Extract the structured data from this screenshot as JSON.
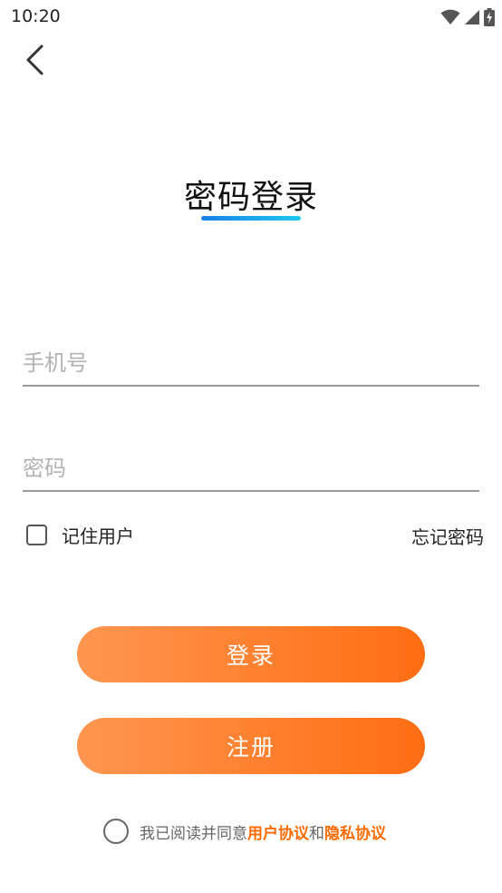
{
  "status_bar": {
    "time": "10:20"
  },
  "title": "密码登录",
  "phone_field": {
    "value": "",
    "placeholder": "手机号"
  },
  "password_field": {
    "value": "",
    "placeholder": "密码"
  },
  "remember": {
    "label": "记住用户",
    "checked": false
  },
  "forgot_password": "忘记密码",
  "buttons": {
    "login": "登录",
    "register": "注册"
  },
  "agreement": {
    "prefix": "我已阅读并同意",
    "user_agreement": "用户协议",
    "and": "和",
    "privacy_policy": "隐私协议",
    "accepted": false
  },
  "colors": {
    "accent_orange": "#ff6d12",
    "underline_blue": "#1a7fe6"
  },
  "icons": {
    "back": "back-arrow-icon",
    "wifi": "wifi-icon",
    "signal": "cellular-signal-icon",
    "battery": "battery-charging-icon"
  }
}
